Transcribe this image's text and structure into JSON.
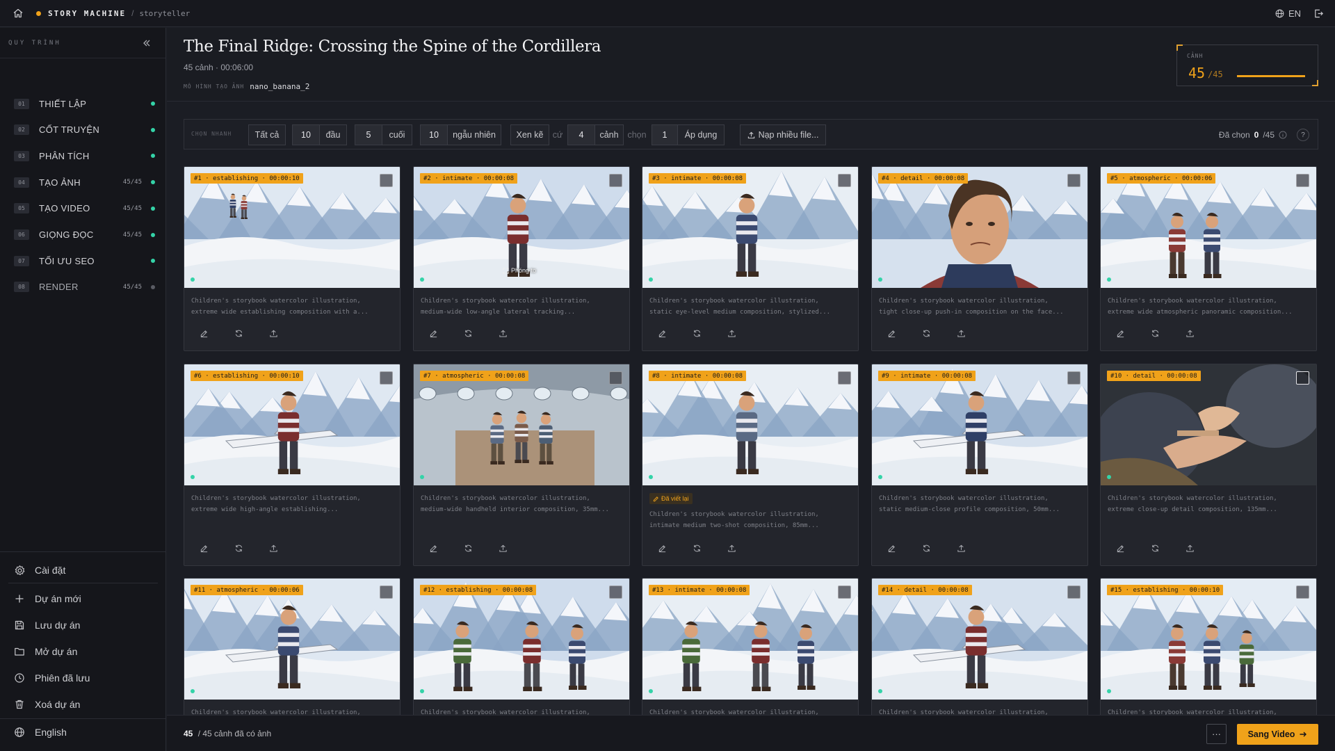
{
  "topbar": {
    "brand": "STORY MACHINE",
    "separator": "/",
    "crumb": "storyteller",
    "lang": "EN"
  },
  "sidebar": {
    "title": "QUY TRÌNH",
    "steps": [
      {
        "num": "01",
        "label": "THIẾT LẬP",
        "count": "",
        "status": "done"
      },
      {
        "num": "02",
        "label": "CỐT TRUYỆN",
        "count": "",
        "status": "done"
      },
      {
        "num": "03",
        "label": "PHÂN TÍCH",
        "count": "",
        "status": "done"
      },
      {
        "num": "04",
        "label": "TẠO ẢNH",
        "count": "45/45",
        "status": "done"
      },
      {
        "num": "05",
        "label": "TẠO VIDEO",
        "count": "45/45",
        "status": "done"
      },
      {
        "num": "06",
        "label": "GIỌNG ĐỌC",
        "count": "45/45",
        "status": "done"
      },
      {
        "num": "07",
        "label": "TỐI ƯU SEO",
        "count": "",
        "status": "done"
      },
      {
        "num": "08",
        "label": "RENDER",
        "count": "45/45",
        "status": "pending"
      }
    ],
    "menu": {
      "settings": "Cài đặt",
      "new_project": "Dự án mới",
      "save_project": "Lưu dự án",
      "open_project": "Mở dự án",
      "saved_sessions": "Phiên đã lưu",
      "delete_project": "Xoá dự án",
      "language": "English"
    }
  },
  "header": {
    "title": "The Final Ridge: Crossing the Spine of the Cordillera",
    "subtitle": "45 cảnh · 00:06:00",
    "model_label": "MÔ HÌNH TẠO ẢNH",
    "model_value": "nano_banana_2",
    "scene_label": "CẢNH",
    "scene_done": "45",
    "scene_total": "/45",
    "scene_progress": 1.0
  },
  "toolbar": {
    "label": "CHỌN NHANH",
    "all": "Tất cả",
    "first_n": "10",
    "first_label": "đầu",
    "last_n": "5",
    "last_label": "cuối",
    "random_n": "10",
    "random_label": "ngẫu nhiên",
    "interleave": "Xen kẽ",
    "every": "cứ",
    "interleave_n": "4",
    "scene_word": "cảnh",
    "pick": "chọn",
    "pick_n": "1",
    "apply": "Áp dụng",
    "upload": "Nạp nhiều file...",
    "selected_label": "Đã chọn",
    "selected_count": "0",
    "selected_total": "/45",
    "help": "?"
  },
  "cards": [
    {
      "tag": "#1 · establishing · 00:00:10",
      "line1": "Children's storybook watercolor illustration,",
      "line2": "extreme wide establishing composition with a..."
    },
    {
      "tag": "#2 · intimate · 00:00:08",
      "line1": "Children's storybook watercolor illustration,",
      "line2": "medium-wide low-angle lateral tracking...",
      "zoom": "Phóng to"
    },
    {
      "tag": "#3 · intimate · 00:00:08",
      "line1": "Children's storybook watercolor illustration,",
      "line2": "static eye-level medium composition, stylized..."
    },
    {
      "tag": "#4 · detail · 00:00:08",
      "line1": "Children's storybook watercolor illustration,",
      "line2": "tight close-up push-in composition on the face..."
    },
    {
      "tag": "#5 · atmospheric · 00:00:06",
      "line1": "Children's storybook watercolor illustration,",
      "line2": "extreme wide atmospheric panoramic composition..."
    },
    {
      "tag": "#6 · establishing · 00:00:10",
      "line1": "Children's storybook watercolor illustration,",
      "line2": "extreme wide high-angle establishing..."
    },
    {
      "tag": "#7 · atmospheric · 00:00:08",
      "line1": "Children's storybook watercolor illustration,",
      "line2": "medium-wide handheld interior composition, 35mm..."
    },
    {
      "tag": "#8 · intimate · 00:00:08",
      "rewrite": "Đã viết lại",
      "line1": "Children's storybook watercolor illustration,",
      "line2": "intimate medium two-shot composition, 85mm..."
    },
    {
      "tag": "#9 · intimate · 00:00:08",
      "line1": "Children's storybook watercolor illustration,",
      "line2": "static medium-close profile composition, 50mm..."
    },
    {
      "tag": "#10 · detail · 00:00:08",
      "line1": "Children's storybook watercolor illustration,",
      "line2": "extreme close-up detail composition, 135mm..."
    },
    {
      "tag": "#11 · atmospheric · 00:00:06",
      "line1": "Children's storybook watercolor illustration,",
      "line2": ""
    },
    {
      "tag": "#12 · establishing · 00:00:08",
      "line1": "Children's storybook watercolor illustration,",
      "line2": ""
    },
    {
      "tag": "#13 · intimate · 00:00:08",
      "line1": "Children's storybook watercolor illustration,",
      "line2": ""
    },
    {
      "tag": "#14 · detail · 00:00:08",
      "line1": "Children's storybook watercolor illustration,",
      "line2": ""
    },
    {
      "tag": "#15 · establishing · 00:00:10",
      "line1": "Children's storybook watercolor illustration,",
      "line2": ""
    }
  ],
  "footer": {
    "count": "45",
    "label": "/ 45 cảnh đã có ảnh",
    "more": "···",
    "next": "Sang Video"
  },
  "colors": {
    "accent": "#f0a21a",
    "done": "#34d3a8",
    "bg": "#1b1d24"
  }
}
